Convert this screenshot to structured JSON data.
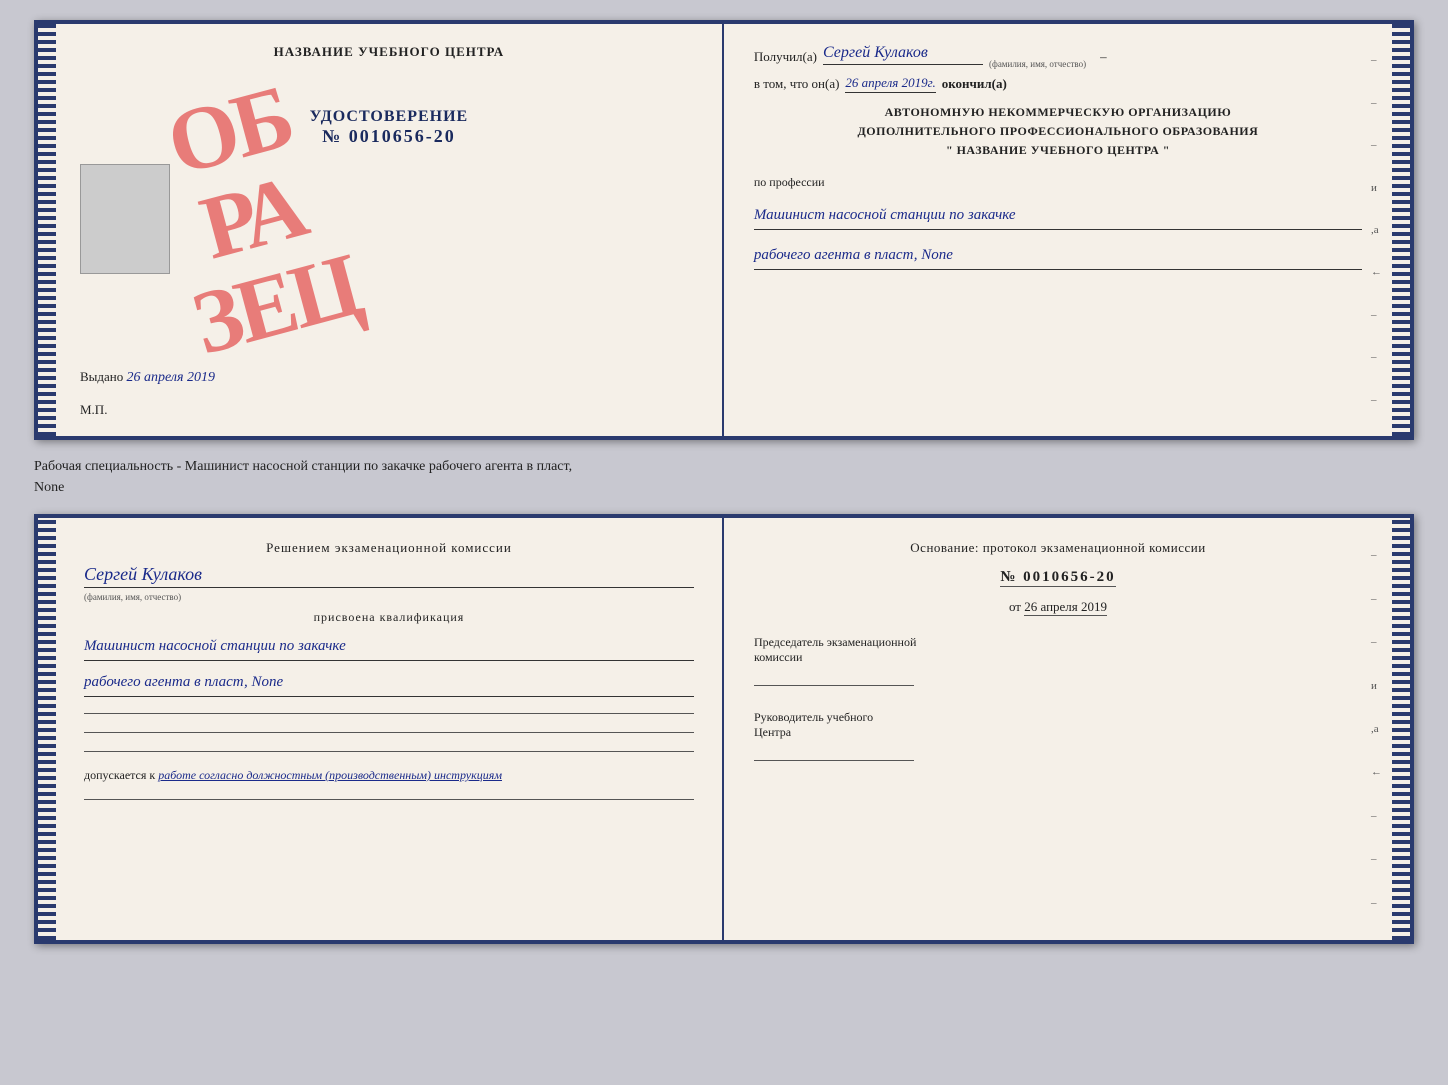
{
  "top_doc": {
    "left": {
      "title": "НАЗВАНИЕ УЧЕБНОГО ЦЕНТРА",
      "stamp": "ОБРАЗЕЦ",
      "udostoverenie_label": "УДОСТОВЕРЕНИЕ",
      "udostoverenie_num": "№ 0010656-20",
      "vydano_label": "Выдано",
      "vydano_date": "26 апреля 2019",
      "mp": "М.П."
    },
    "right": {
      "poluchil_label": "Получил(а)",
      "poluchil_name": "Сергей Кулаков",
      "fio_hint": "(фамилия, имя, отчество)",
      "vtom_label": "в том, что он(а)",
      "vtom_date": "26 апреля 2019г.",
      "okoncil_label": "окончил(а)",
      "org_line1": "АВТОНОМНУЮ НЕКОММЕРЧЕСКУЮ ОРГАНИЗАЦИЮ",
      "org_line2": "ДОПОЛНИТЕЛЬНОГО ПРОФЕССИОНАЛЬНОГО ОБРАЗОВАНИЯ",
      "org_line3": "\" НАЗВАНИЕ УЧЕБНОГО ЦЕНТРА \"",
      "po_professii": "по профессии",
      "profession_line1": "Машинист насосной станции по закачке",
      "profession_line2": "рабочего агента в пласт, None"
    }
  },
  "middle": {
    "text": "Рабочая специальность - Машинист насосной станции по закачке рабочего агента в пласт,",
    "text2": "None"
  },
  "bottom_doc": {
    "left": {
      "resheniem": "Решением экзаменационной комиссии",
      "name": "Сергей Кулаков",
      "fio_hint": "(фамилия, имя, отчество)",
      "prisvoeena": "присвоена квалификация",
      "profession_line1": "Машинист насосной станции по закачке",
      "profession_line2": "рабочего агента в пласт, None",
      "dopuskaetsya": "допускается к",
      "dopusk_text": "работе согласно должностным (производственным) инструкциям"
    },
    "right": {
      "osnov": "Основание: протокол экзаменационной комиссии",
      "num": "№ 0010656-20",
      "ot_label": "от",
      "ot_date": "26 апреля 2019",
      "predsedatel_line1": "Председатель экзаменационной",
      "predsedatel_line2": "комиссии",
      "rukov_line1": "Руководитель учебного",
      "rukov_line2": "Центра"
    }
  }
}
